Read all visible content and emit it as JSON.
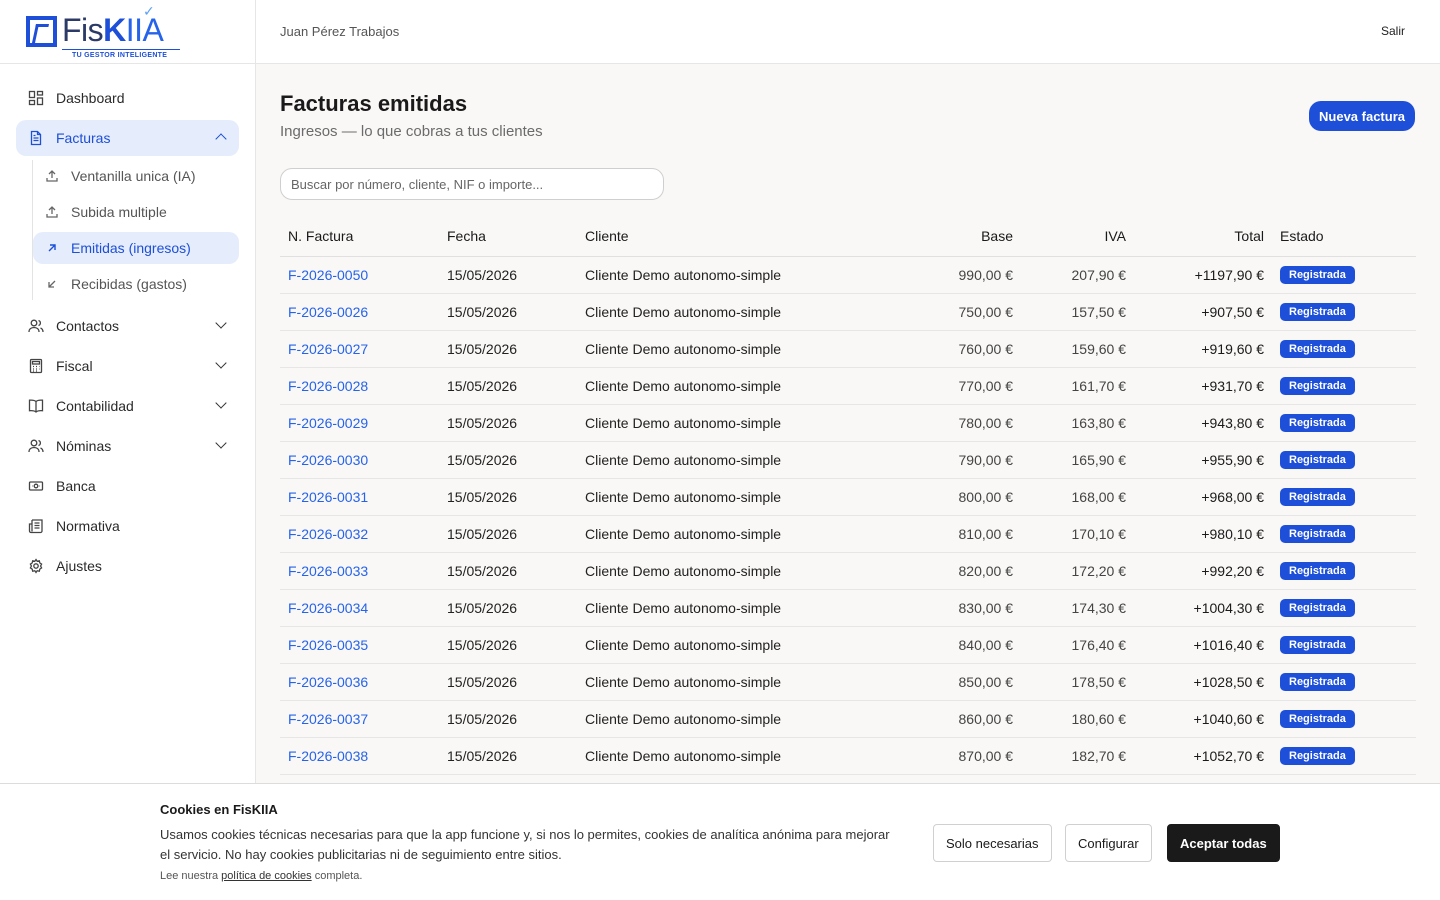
{
  "brand": {
    "name_prefix": "Fis",
    "name_k": "K",
    "name_suffix": "IIA",
    "tagline": "TU GESTOR INTELIGENTE",
    "accent": "#1d4fd8"
  },
  "header": {
    "user": "Juan Pérez Trabajos",
    "logout": "Salir"
  },
  "sidebar": {
    "items": [
      {
        "label": "Dashboard",
        "icon": "grid-icon"
      },
      {
        "label": "Facturas",
        "icon": "document-icon",
        "expanded": true
      },
      {
        "label": "Contactos",
        "icon": "users-icon"
      },
      {
        "label": "Fiscal",
        "icon": "calculator-icon"
      },
      {
        "label": "Contabilidad",
        "icon": "book-icon"
      },
      {
        "label": "Nóminas",
        "icon": "users-icon"
      },
      {
        "label": "Banca",
        "icon": "banknote-icon"
      },
      {
        "label": "Normativa",
        "icon": "newspaper-icon"
      },
      {
        "label": "Ajustes",
        "icon": "gear-icon"
      }
    ],
    "facturas_sub": [
      {
        "label": "Ventanilla unica (IA)",
        "icon": "upload-icon"
      },
      {
        "label": "Subida multiple",
        "icon": "upload-icon"
      },
      {
        "label": "Emitidas (ingresos)",
        "icon": "arrow-up-right-icon",
        "active": true
      },
      {
        "label": "Recibidas (gastos)",
        "icon": "arrow-down-left-icon"
      }
    ]
  },
  "main": {
    "title": "Facturas emitidas",
    "subtitle": "Ingresos — lo que cobras a tus clientes",
    "new_button": "Nueva factura",
    "search_placeholder": "Buscar por número, cliente, NIF o importe...",
    "columns": [
      "N. Factura",
      "Fecha",
      "Cliente",
      "Base",
      "IVA",
      "Total",
      "Estado"
    ],
    "rows": [
      {
        "num": "F-2026-0050",
        "fecha": "15/05/2026",
        "cliente": "Cliente Demo autonomo-simple",
        "base": "990,00 €",
        "iva": "207,90 €",
        "total": "+1197,90 €",
        "estado": "Registrada"
      },
      {
        "num": "F-2026-0026",
        "fecha": "15/05/2026",
        "cliente": "Cliente Demo autonomo-simple",
        "base": "750,00 €",
        "iva": "157,50 €",
        "total": "+907,50 €",
        "estado": "Registrada"
      },
      {
        "num": "F-2026-0027",
        "fecha": "15/05/2026",
        "cliente": "Cliente Demo autonomo-simple",
        "base": "760,00 €",
        "iva": "159,60 €",
        "total": "+919,60 €",
        "estado": "Registrada"
      },
      {
        "num": "F-2026-0028",
        "fecha": "15/05/2026",
        "cliente": "Cliente Demo autonomo-simple",
        "base": "770,00 €",
        "iva": "161,70 €",
        "total": "+931,70 €",
        "estado": "Registrada"
      },
      {
        "num": "F-2026-0029",
        "fecha": "15/05/2026",
        "cliente": "Cliente Demo autonomo-simple",
        "base": "780,00 €",
        "iva": "163,80 €",
        "total": "+943,80 €",
        "estado": "Registrada"
      },
      {
        "num": "F-2026-0030",
        "fecha": "15/05/2026",
        "cliente": "Cliente Demo autonomo-simple",
        "base": "790,00 €",
        "iva": "165,90 €",
        "total": "+955,90 €",
        "estado": "Registrada"
      },
      {
        "num": "F-2026-0031",
        "fecha": "15/05/2026",
        "cliente": "Cliente Demo autonomo-simple",
        "base": "800,00 €",
        "iva": "168,00 €",
        "total": "+968,00 €",
        "estado": "Registrada"
      },
      {
        "num": "F-2026-0032",
        "fecha": "15/05/2026",
        "cliente": "Cliente Demo autonomo-simple",
        "base": "810,00 €",
        "iva": "170,10 €",
        "total": "+980,10 €",
        "estado": "Registrada"
      },
      {
        "num": "F-2026-0033",
        "fecha": "15/05/2026",
        "cliente": "Cliente Demo autonomo-simple",
        "base": "820,00 €",
        "iva": "172,20 €",
        "total": "+992,20 €",
        "estado": "Registrada"
      },
      {
        "num": "F-2026-0034",
        "fecha": "15/05/2026",
        "cliente": "Cliente Demo autonomo-simple",
        "base": "830,00 €",
        "iva": "174,30 €",
        "total": "+1004,30 €",
        "estado": "Registrada"
      },
      {
        "num": "F-2026-0035",
        "fecha": "15/05/2026",
        "cliente": "Cliente Demo autonomo-simple",
        "base": "840,00 €",
        "iva": "176,40 €",
        "total": "+1016,40 €",
        "estado": "Registrada"
      },
      {
        "num": "F-2026-0036",
        "fecha": "15/05/2026",
        "cliente": "Cliente Demo autonomo-simple",
        "base": "850,00 €",
        "iva": "178,50 €",
        "total": "+1028,50 €",
        "estado": "Registrada"
      },
      {
        "num": "F-2026-0037",
        "fecha": "15/05/2026",
        "cliente": "Cliente Demo autonomo-simple",
        "base": "860,00 €",
        "iva": "180,60 €",
        "total": "+1040,60 €",
        "estado": "Registrada"
      },
      {
        "num": "F-2026-0038",
        "fecha": "15/05/2026",
        "cliente": "Cliente Demo autonomo-simple",
        "base": "870,00 €",
        "iva": "182,70 €",
        "total": "+1052,70 €",
        "estado": "Registrada"
      }
    ]
  },
  "cookies": {
    "title": "Cookies en FisKIIA",
    "text": "Usamos cookies técnicas necesarias para que la app funcione y, si nos lo permites, cookies de analítica anónima para mejorar el servicio. No hay cookies publicitarias ni de seguimiento entre sitios.",
    "small_prefix": "Lee nuestra ",
    "small_link": "política de cookies",
    "small_suffix": " completa.",
    "btn_necessary": "Solo necesarias",
    "btn_configure": "Configurar",
    "btn_accept": "Aceptar todas"
  }
}
